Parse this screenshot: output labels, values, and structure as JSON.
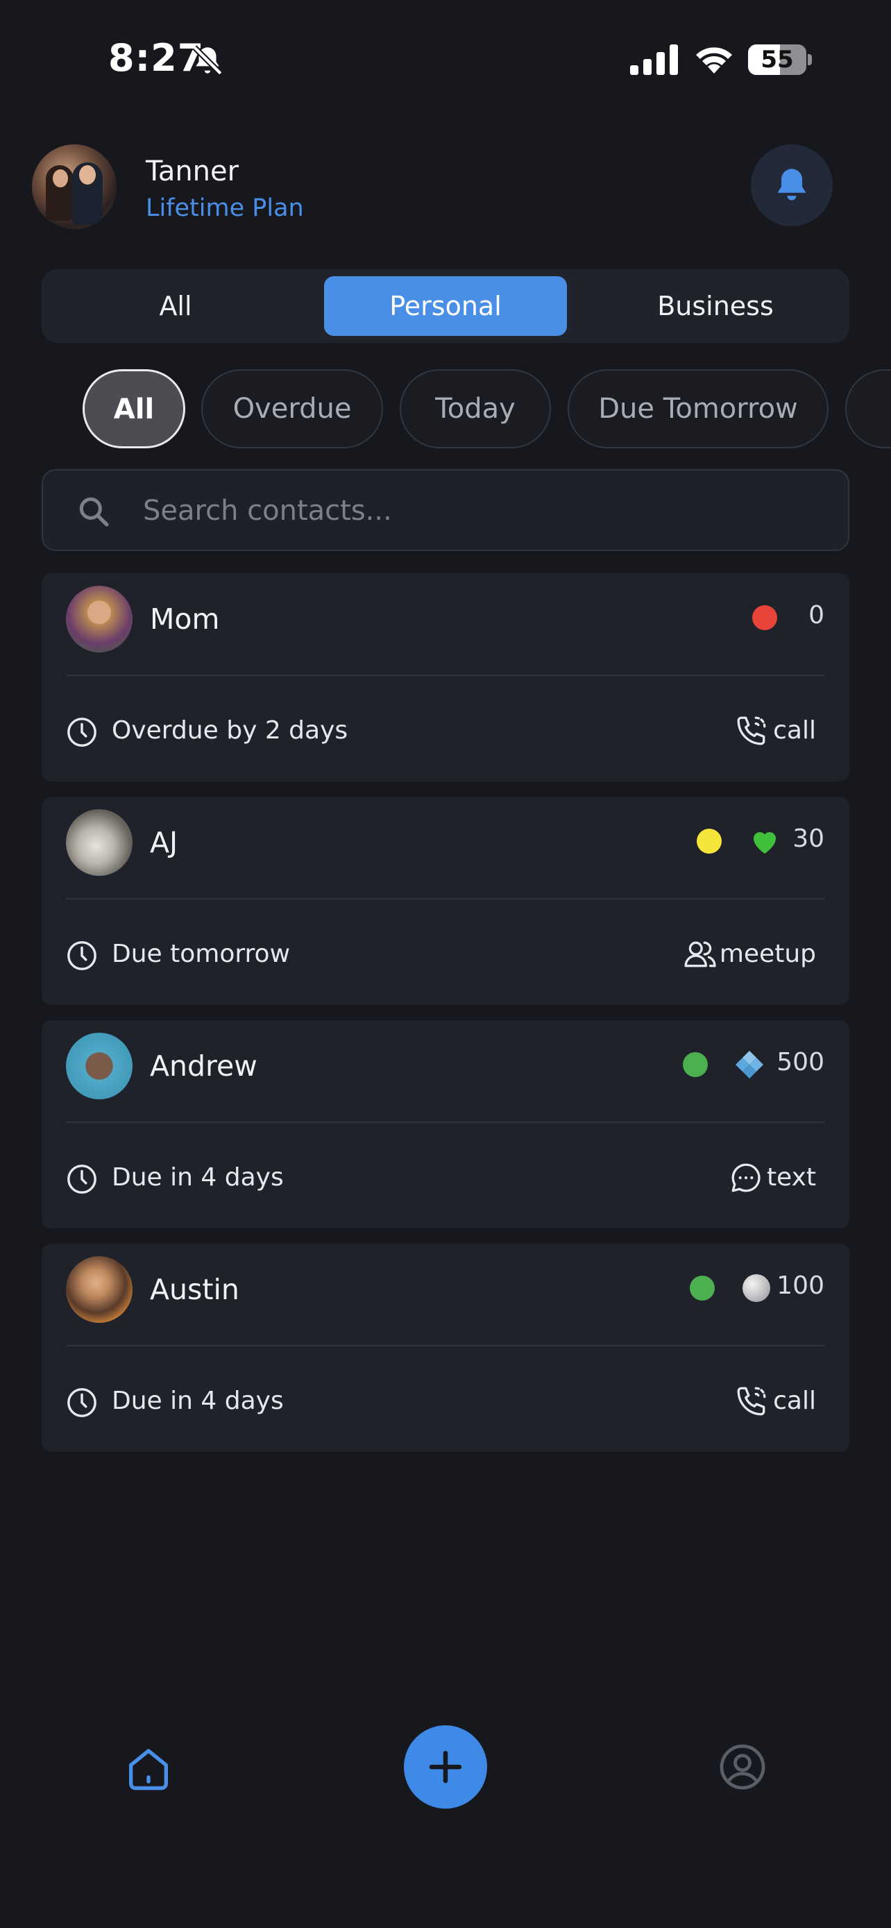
{
  "status_bar": {
    "time": "8:27",
    "battery": "55",
    "battery_level": 0.55
  },
  "header": {
    "user_name": "Tanner",
    "plan": "Lifetime Plan"
  },
  "tabs": [
    "All",
    "Personal",
    "Business"
  ],
  "active_tab": "Personal",
  "filters": [
    "All",
    "Overdue",
    "Today",
    "Due Tomorrow"
  ],
  "active_filter": "All",
  "search": {
    "placeholder": "Search contacts..."
  },
  "contacts": [
    {
      "name": "Mom",
      "status_color": "#e8443a",
      "badge": "",
      "score": "0",
      "due": "Overdue by 2 days",
      "action": "call",
      "action_icon": "phone-icon"
    },
    {
      "name": "AJ",
      "status_color": "#f5e43a",
      "badge": "green-heart-icon",
      "score": "30",
      "due": "Due tomorrow",
      "action": "meetup",
      "action_icon": "people-icon"
    },
    {
      "name": "Andrew",
      "status_color": "#4caf50",
      "badge": "diamond-icon",
      "score": "500",
      "due": "Due in 4 days",
      "action": "text",
      "action_icon": "chat-icon"
    },
    {
      "name": "Austin",
      "status_color": "#4caf50",
      "badge": "silver-circle-icon",
      "score": "100",
      "due": "Due in 4 days",
      "action": "call",
      "action_icon": "phone-icon"
    }
  ],
  "colors": {
    "accent": "#4a8fe7",
    "background": "#16181e",
    "card": "#1f222a"
  }
}
